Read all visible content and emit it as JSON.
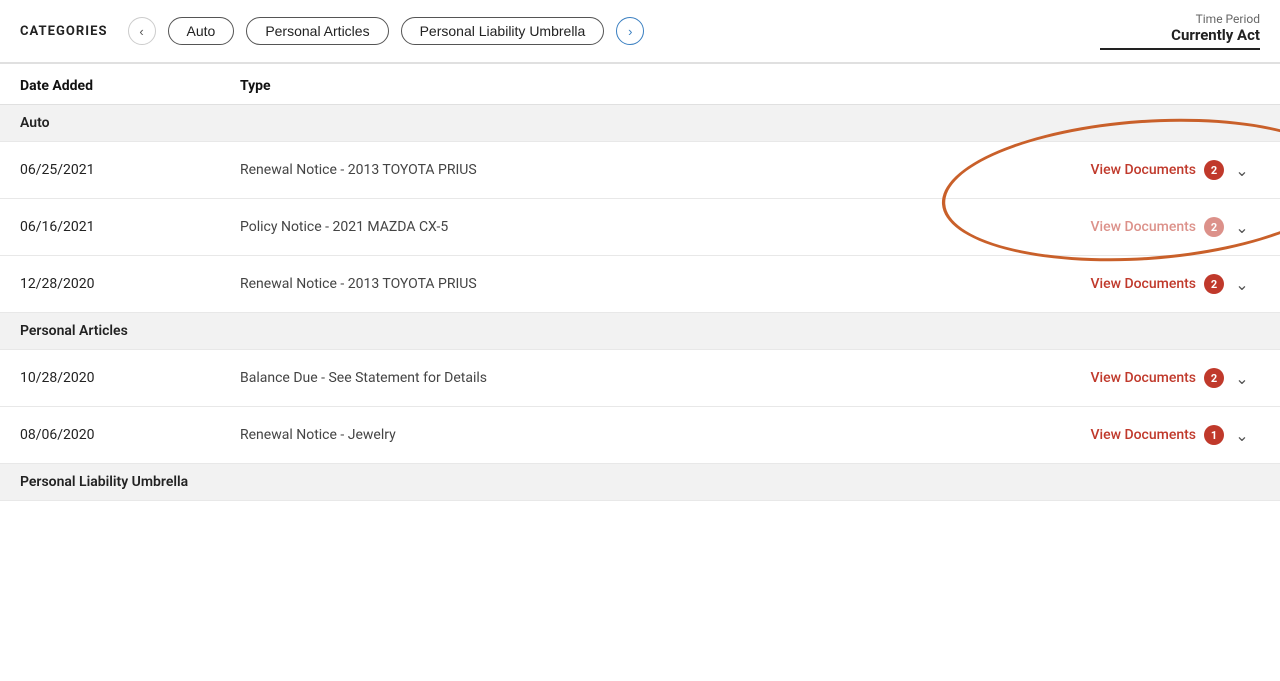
{
  "header": {
    "categories_label": "CATEGORIES",
    "time_period_label": "Time Period",
    "time_period_value": "Currently Act"
  },
  "nav": {
    "prev_arrow": "‹",
    "next_arrow": "›",
    "pills": [
      "Auto",
      "Personal Articles",
      "Personal Liability Umbrella"
    ]
  },
  "table": {
    "col_date": "Date Added",
    "col_type": "Type",
    "sections": [
      {
        "section_name": "Auto",
        "rows": [
          {
            "date": "06/25/2021",
            "type": "Renewal Notice - 2013 TOYOTA PRIUS",
            "link_label": "View Documents",
            "badge_count": "2",
            "annotated": true
          },
          {
            "date": "06/16/2021",
            "type": "Policy Notice - 2021 MAZDA CX-5",
            "link_label": "View Documents",
            "badge_count": "2",
            "annotated": false
          },
          {
            "date": "12/28/2020",
            "type": "Renewal Notice - 2013 TOYOTA PRIUS",
            "link_label": "View Documents",
            "badge_count": "2",
            "annotated": false
          }
        ]
      },
      {
        "section_name": "Personal Articles",
        "rows": [
          {
            "date": "10/28/2020",
            "type": "Balance Due - See Statement for Details",
            "link_label": "View Documents",
            "badge_count": "2",
            "annotated": false
          },
          {
            "date": "08/06/2020",
            "type": "Renewal Notice - Jewelry",
            "link_label": "View Documents",
            "badge_count": "1",
            "annotated": false
          }
        ]
      },
      {
        "section_name": "Personal Liability Umbrella",
        "rows": []
      }
    ]
  }
}
